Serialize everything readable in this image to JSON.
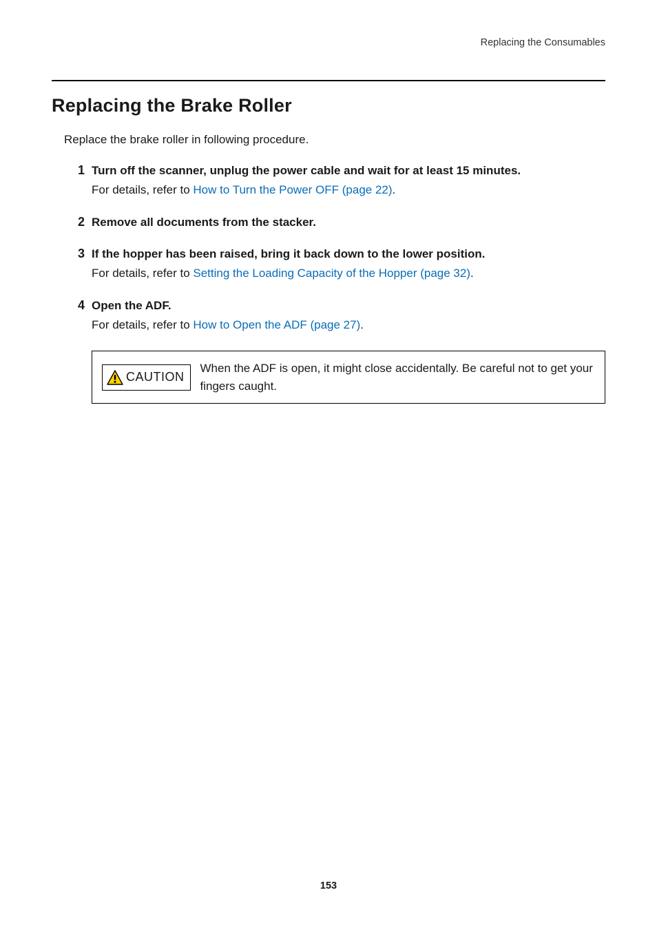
{
  "header": {
    "chapter": "Replacing the Consumables"
  },
  "section": {
    "title": "Replacing the Brake Roller",
    "intro": "Replace the brake roller in following procedure."
  },
  "steps": [
    {
      "num": "1",
      "heading": "Turn off the scanner, unplug the power cable and wait for at least 15 minutes.",
      "detail_prefix": "For details, refer to ",
      "link_text": "How to Turn the Power OFF (page 22)",
      "detail_suffix": "."
    },
    {
      "num": "2",
      "heading": "Remove all documents from the stacker."
    },
    {
      "num": "3",
      "heading": "If the hopper has been raised, bring it back down to the lower position.",
      "detail_prefix": "For details, refer to ",
      "link_text": "Setting the Loading Capacity of the Hopper (page 32)",
      "detail_suffix": "."
    },
    {
      "num": "4",
      "heading": "Open the ADF.",
      "detail_prefix": "For details, refer to ",
      "link_text": "How to Open the ADF (page 27)",
      "detail_suffix": "."
    }
  ],
  "caution": {
    "label": "CAUTION",
    "text": "When the ADF is open, it might close accidentally. Be careful not to get your fingers caught."
  },
  "page_number": "153"
}
